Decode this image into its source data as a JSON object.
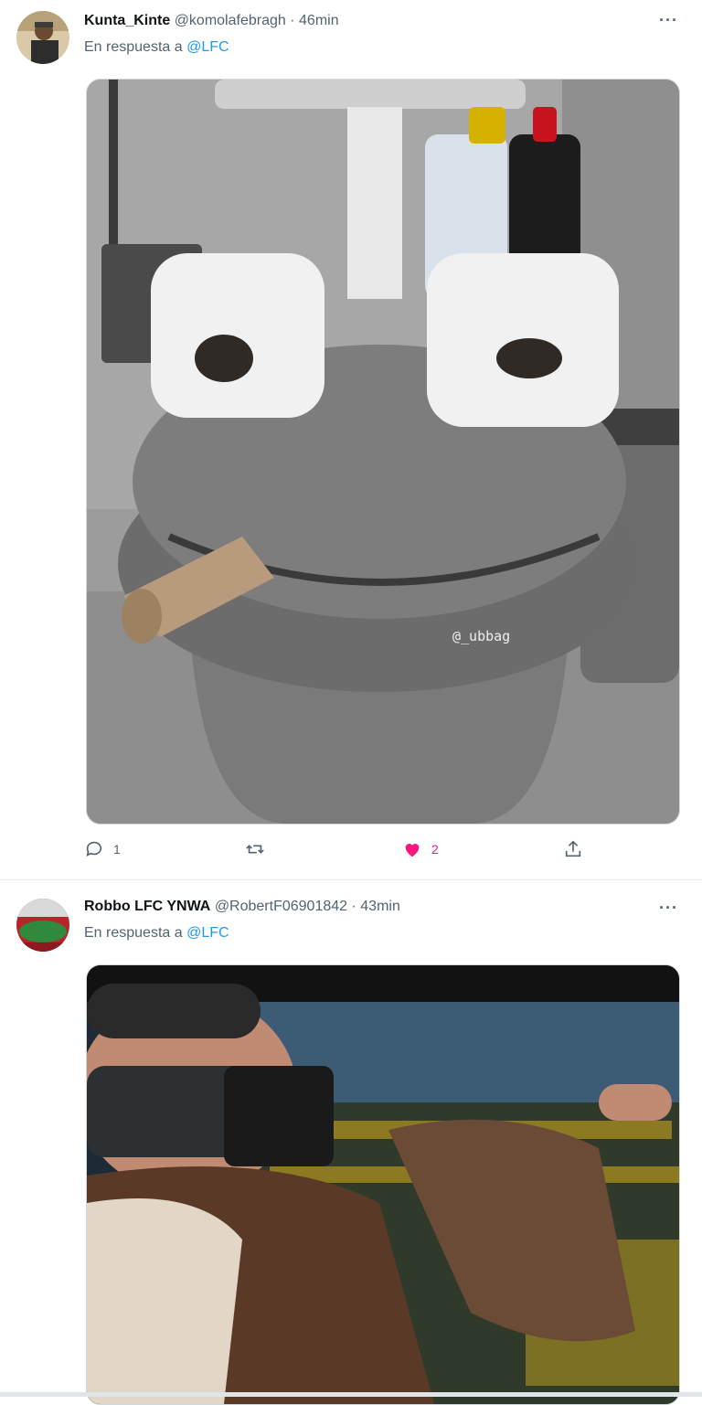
{
  "tweets": [
    {
      "display_name": "Kunta_Kinte",
      "handle": "@komolafebragh",
      "separator": "·",
      "time": "46min",
      "reply_prefix": "En respuesta a",
      "reply_to": "@LFC",
      "more": "···",
      "media_watermark": "@_ubbag",
      "actions": {
        "replies": "1",
        "retweets": "",
        "likes": "2",
        "liked": true
      }
    },
    {
      "display_name": "Robbo LFC YNWA",
      "handle": "@RobertF06901842",
      "separator": "·",
      "time": "43min",
      "reply_prefix": "En respuesta a",
      "reply_to": "@LFC",
      "more": "···"
    }
  ],
  "colors": {
    "accent": "#1d9bf0",
    "like": "#f91880",
    "secondary_text": "#536471"
  },
  "icons": [
    "reply-icon",
    "retweet-icon",
    "like-icon",
    "share-icon",
    "more-icon"
  ]
}
